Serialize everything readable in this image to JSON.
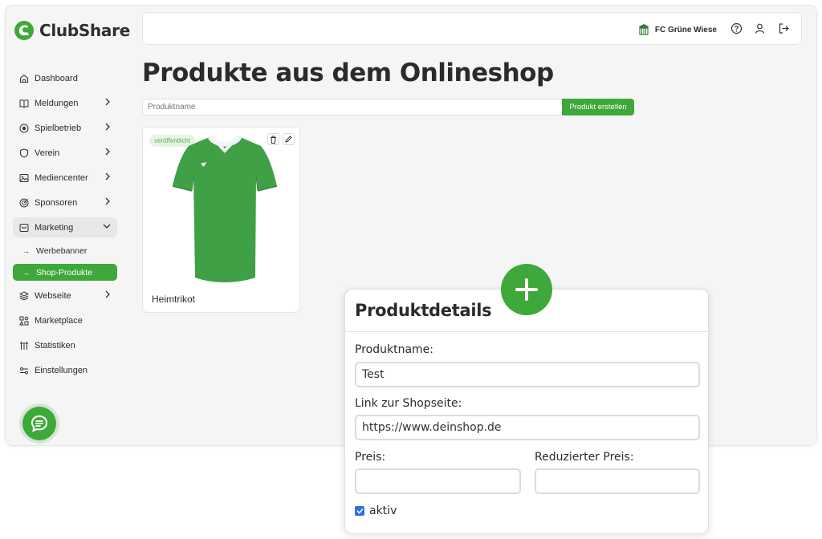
{
  "brand": {
    "name": "ClubShare",
    "color": "#3fa83b"
  },
  "sidebar": {
    "items": [
      {
        "label": "Dashboard",
        "icon": "home-icon"
      },
      {
        "label": "Meldungen",
        "icon": "book-icon"
      },
      {
        "label": "Spielbetrieb",
        "icon": "ball-icon"
      },
      {
        "label": "Verein",
        "icon": "shield-icon"
      },
      {
        "label": "Mediencenter",
        "icon": "image-icon"
      },
      {
        "label": "Sponsoren",
        "icon": "target-icon"
      },
      {
        "label": "Marketing",
        "icon": "marketing-icon"
      },
      {
        "label": "Werbebanner"
      },
      {
        "label": "Shop-Produkte"
      },
      {
        "label": "Webseite",
        "icon": "layers-icon"
      },
      {
        "label": "Marketplace",
        "icon": "marketplace-icon"
      },
      {
        "label": "Statistiken",
        "icon": "stats-icon"
      },
      {
        "label": "Einstellungen",
        "icon": "settings-icon"
      }
    ]
  },
  "topbar": {
    "club_name": "FC Grüne Wiese"
  },
  "page": {
    "title": "Produkte aus dem Onlineshop"
  },
  "search": {
    "placeholder": "Produktname",
    "create_label": "Produkt erstellen"
  },
  "product": {
    "badge": "veröffentlicht",
    "title": "Heimtrikot"
  },
  "modal": {
    "title": "Produktdetails",
    "name_label": "Produktname:",
    "name_value": "Test",
    "link_label": "Link zur Shopseite:",
    "link_value": "https://www.deinshop.de",
    "price_label": "Preis:",
    "price_value": "",
    "reduced_label": "Reduzierter Preis:",
    "reduced_value": "",
    "active_label": "aktiv",
    "active_checked": true
  }
}
